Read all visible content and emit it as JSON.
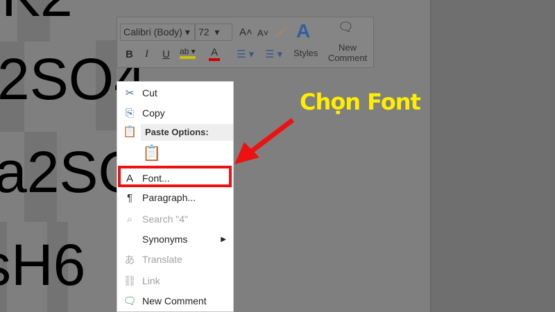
{
  "document": {
    "lines": [
      "K2",
      "2SO4",
      "a2SO",
      "sH6"
    ]
  },
  "mini_toolbar": {
    "font_name": "Calibri (Body)",
    "font_size": "72",
    "styles_label": "Styles",
    "new_comment_label": "New Comment",
    "bold": "B",
    "italic": "I",
    "underline": "U",
    "font_color": "A"
  },
  "context_menu": {
    "cut": "Cut",
    "copy": "Copy",
    "paste_options": "Paste Options:",
    "font": "Font...",
    "paragraph": "Paragraph...",
    "search": "Search \"4\"",
    "synonyms": "Synonyms",
    "translate": "Translate",
    "link": "Link",
    "new_comment": "New Comment"
  },
  "annotation": {
    "label": "Chọn Font",
    "highlight_color": "#ee1111",
    "label_color": "#ffee00"
  }
}
